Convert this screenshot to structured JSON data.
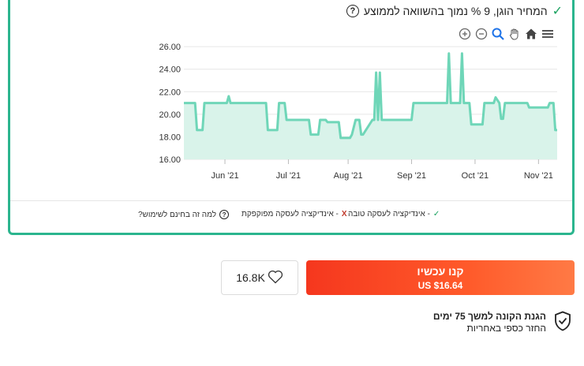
{
  "headline": {
    "text": "המחיר הוגן, 9 % נמוך בהשוואה לממוצע",
    "check_icon": "check-icon",
    "help_icon": "help-circle-icon"
  },
  "toolbar": {
    "icons": [
      "menu-icon",
      "home-icon",
      "pan-hand-icon",
      "zoom-icon",
      "zoom-out-icon",
      "zoom-in-icon"
    ]
  },
  "chart_data": {
    "type": "area",
    "ylim": [
      16,
      26.5
    ],
    "yticks": [
      "26.00",
      "24.00",
      "22.00",
      "20.00",
      "18.00",
      "16.00"
    ],
    "ytick_values": [
      26,
      24,
      22,
      20,
      18,
      16
    ],
    "xtick_labels": [
      "Jun '21",
      "Jul '21",
      "Aug '21",
      "Sep '21",
      "Oct '21",
      "Nov '21"
    ],
    "xtick_values": [
      0.11,
      0.28,
      0.44,
      0.61,
      0.78,
      0.95
    ],
    "line_color": "#6fd6b8",
    "fill_color": "#d9f3ea",
    "grid": true,
    "series": [
      {
        "x": [
          0,
          0.03,
          0.035,
          0.05,
          0.055,
          0.115,
          0.12,
          0.125,
          0.13,
          0.22,
          0.225,
          0.25,
          0.255,
          0.27,
          0.275,
          0.335,
          0.34,
          0.36,
          0.365,
          0.38,
          0.385,
          0.415,
          0.42,
          0.445,
          0.45,
          0.46,
          0.47,
          0.475,
          0.48,
          0.505,
          0.51,
          0.515,
          0.52,
          0.525,
          0.53,
          0.61,
          0.615,
          0.705,
          0.71,
          0.715,
          0.72,
          0.74,
          0.745,
          0.75,
          0.755,
          0.765,
          0.77,
          0.8,
          0.805,
          0.83,
          0.835,
          0.845,
          0.85,
          0.855,
          0.86,
          0.87,
          0.875,
          0.92,
          0.925,
          0.975,
          0.98,
          0.99,
          0.995,
          1
        ],
        "y": [
          21,
          21,
          18.6,
          18.6,
          21,
          21,
          21.6,
          21,
          21,
          21,
          18.6,
          18.6,
          21,
          21,
          19.5,
          19.5,
          18.2,
          18.2,
          19.5,
          19.5,
          19.3,
          19.3,
          17.9,
          17.9,
          18.2,
          19.5,
          19.5,
          18.2,
          18.2,
          19.5,
          19.5,
          23.7,
          19.5,
          23.7,
          19.5,
          19.5,
          21,
          21,
          25.4,
          21,
          21,
          21,
          25.4,
          21,
          21,
          21,
          19.1,
          19.1,
          21,
          21,
          21.5,
          21,
          19.6,
          19.6,
          21,
          21,
          21,
          21,
          20.6,
          20.6,
          21,
          21,
          18.6,
          18.6
        ]
      }
    ]
  },
  "legend": {
    "good": {
      "mark": "✓",
      "label": "- אינדיקציה לעסקה טובה"
    },
    "bad": {
      "mark": "X",
      "label": "- אינדיקציה לעסקה מפוקפקת"
    },
    "info": {
      "label": "למה זה בחינם לשימוש?"
    }
  },
  "actions": {
    "buy_title": "קנו עכשיו",
    "buy_price": "US $16.64",
    "wishlist_count": "16.8K",
    "wishlist_icon": "heart-icon"
  },
  "guarantee": {
    "title": "הגנת הקונה למשך 75 ימים",
    "subtitle": "החזר כספי באחריות",
    "icon": "shield-check-icon"
  },
  "colors": {
    "accent_border": "#2bb58e",
    "buy_gradient_start": "#f5371e",
    "buy_gradient_end": "#ff7a45"
  }
}
